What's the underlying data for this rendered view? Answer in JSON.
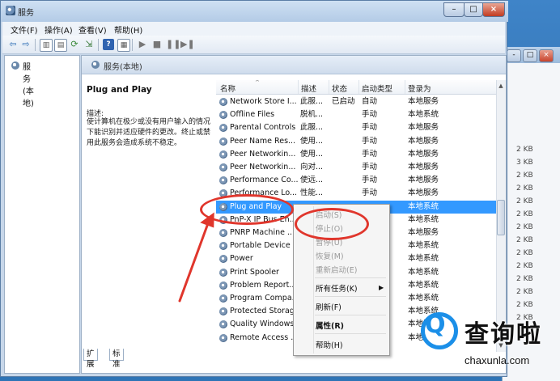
{
  "window": {
    "title": "服务",
    "controls": [
      "minimize",
      "maximize",
      "close"
    ]
  },
  "menubar": {
    "items": [
      "文件(F)",
      "操作(A)",
      "查看(V)",
      "帮助(H)"
    ]
  },
  "tree": {
    "root_label": "服务(本地)"
  },
  "content_header": {
    "label": "服务(本地)"
  },
  "description": {
    "service_name": "Plug and Play",
    "label": "描述:",
    "text": "使计算机在极少或没有用户输入的情况下能识别并适应硬件的更改。终止或禁用此服务会造成系统不稳定。"
  },
  "list": {
    "columns": [
      "名称",
      "描述",
      "状态",
      "启动类型",
      "登录为"
    ],
    "rows": [
      {
        "name": "Network Store I...",
        "desc": "此服...",
        "status": "已启动",
        "startup": "自动",
        "logon": "本地服务"
      },
      {
        "name": "Offline Files",
        "desc": "脱机...",
        "status": "",
        "startup": "手动",
        "logon": "本地系统"
      },
      {
        "name": "Parental Controls",
        "desc": "此服...",
        "status": "",
        "startup": "手动",
        "logon": "本地服务"
      },
      {
        "name": "Peer Name Res...",
        "desc": "使用...",
        "status": "",
        "startup": "手动",
        "logon": "本地服务"
      },
      {
        "name": "Peer Networkin...",
        "desc": "使用...",
        "status": "",
        "startup": "手动",
        "logon": "本地服务"
      },
      {
        "name": "Peer Networkin...",
        "desc": "向对...",
        "status": "",
        "startup": "手动",
        "logon": "本地服务"
      },
      {
        "name": "Performance Co...",
        "desc": "使远...",
        "status": "",
        "startup": "手动",
        "logon": "本地服务"
      },
      {
        "name": "Performance Lo...",
        "desc": "性能...",
        "status": "",
        "startup": "手动",
        "logon": "本地服务"
      },
      {
        "name": "Plug and Play",
        "desc": "",
        "status": "",
        "startup": "",
        "logon": "本地系统",
        "selected": true
      },
      {
        "name": "PnP-X IP Bus En...",
        "desc": "",
        "status": "",
        "startup": "",
        "logon": "本地系统"
      },
      {
        "name": "PNRP Machine ...",
        "desc": "",
        "status": "",
        "startup": "",
        "logon": "本地服务"
      },
      {
        "name": "Portable Device ...",
        "desc": "",
        "status": "",
        "startup": "",
        "logon": "本地系统"
      },
      {
        "name": "Power",
        "desc": "",
        "status": "",
        "startup": "",
        "logon": "本地系统"
      },
      {
        "name": "Print Spooler",
        "desc": "",
        "status": "",
        "startup": "",
        "logon": "本地系统"
      },
      {
        "name": "Problem Report...",
        "desc": "",
        "status": "",
        "startup": "",
        "logon": "本地系统"
      },
      {
        "name": "Program Compa...",
        "desc": "",
        "status": "",
        "startup": "",
        "logon": "本地系统"
      },
      {
        "name": "Protected Storage",
        "desc": "",
        "status": "",
        "startup": "",
        "logon": "本地系统"
      },
      {
        "name": "Quality Windows...",
        "desc": "",
        "status": "",
        "startup": "",
        "logon": "本地服务"
      },
      {
        "name": "Remote Access ...",
        "desc": "",
        "status": "",
        "startup": "",
        "logon": "本地系统"
      }
    ]
  },
  "tabs": [
    "扩展",
    "标准"
  ],
  "context_menu": {
    "items": [
      {
        "label": "启动(S)",
        "disabled": true
      },
      {
        "label": "停止(O)",
        "disabled": true
      },
      {
        "label": "暂停(U)",
        "disabled": true
      },
      {
        "label": "恢复(M)",
        "disabled": true
      },
      {
        "label": "重新启动(E)",
        "disabled": true
      },
      {
        "label": "所有任务(K)",
        "disabled": false,
        "submenu": true
      },
      {
        "label": "刷新(F)",
        "disabled": false
      },
      {
        "label": "属性(R)",
        "disabled": false,
        "bold": true
      },
      {
        "label": "帮助(H)",
        "disabled": false
      }
    ]
  },
  "background_window": {
    "sizes": [
      "2 KB",
      "3 KB",
      "2 KB",
      "2 KB",
      "2 KB",
      "2 KB",
      "2 KB",
      "2 KB",
      "2 KB",
      "2 KB",
      "2 KB",
      "2 KB",
      "2 KB",
      "2 KB"
    ]
  },
  "annotation_color": "#e0362c",
  "selection_color": "#3399ff",
  "watermark": {
    "brand": "查询啦",
    "url": "chaxunla.com",
    "accent": "#1b8fe8"
  }
}
